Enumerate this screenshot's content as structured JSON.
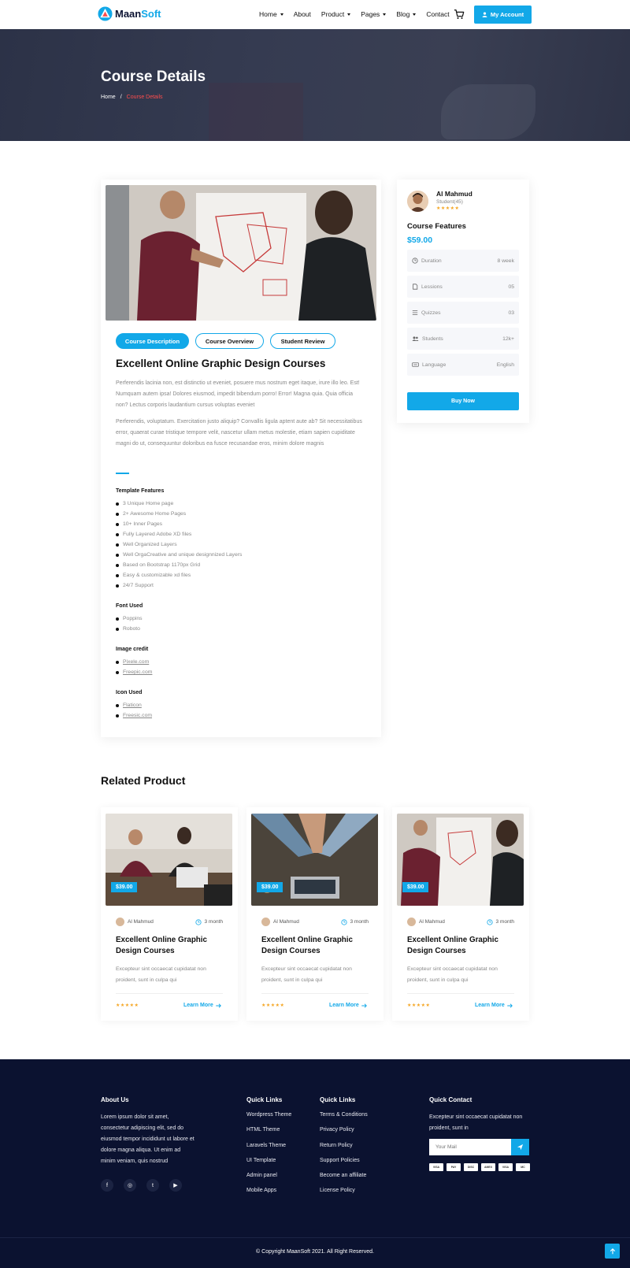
{
  "header": {
    "logo_prefix": "Maan",
    "logo_suffix": "Soft",
    "nav": [
      {
        "label": "Home",
        "dropdown": true
      },
      {
        "label": "About",
        "dropdown": false
      },
      {
        "label": "Product",
        "dropdown": true
      },
      {
        "label": "Pages",
        "dropdown": true
      },
      {
        "label": "Blog",
        "dropdown": true
      },
      {
        "label": "Contact",
        "dropdown": false
      }
    ],
    "account_label": "My Account"
  },
  "hero": {
    "title": "Course Details",
    "breadcrumb": [
      "Home",
      "/",
      "Course Details"
    ]
  },
  "course": {
    "tabs": [
      "Course Description",
      "Course Overview",
      "Student Review"
    ],
    "active_tab": "Course Description",
    "title": "Excellent Online Graphic Design Courses",
    "paragraph1": "Perferendis lacinia non, est distinctio ut eveniet, posuere mus nostrum eget itaque, irure illo leo. Est! Numquam autem ipsa! Dolores eiusmod, impedit bibendum porro! Error! Magna quia. Quia officia non? Lectus corporis laudantium cursus voluptas eveniet",
    "paragraph2": "Perferendis, voluptatum. Exercitation justo aliquip? Convallis ligula aptent aute ab? Sit necessitatibus error, quaerat curae tristique tempore velit, nascetur ullam metus molestie, etiam sapien cupiditate magni do ut, consequuntur doloribus ea fusce recusandae eros, minim dolore magnis",
    "template_features_title": "Template Features",
    "template_features": [
      "3 Unique Home page",
      "2+ Awesome Home Pages",
      "10+ Inner Pages",
      "Fully Layered Adobe XD files",
      "Well Organized Layers",
      "Well OrgaCreative and unique designnized Layers",
      "Based on Bootstrap 1170px Grid",
      "Easy & customizable xd files",
      "24/7 Support"
    ],
    "font_used_title": "Font Used",
    "font_used": [
      "Poppins",
      "Roboto"
    ],
    "image_credit_title": "Image credit",
    "image_credit": [
      "Pixele.com",
      "Freepic.com"
    ],
    "icon_used_title": "Icon Used",
    "icon_used": [
      "Flaticon",
      "Freesic.com"
    ]
  },
  "sidebar": {
    "instructor_name": "Al Mahmud",
    "instructor_role": "Student(45)",
    "stars": "★★★★★",
    "features_title": "Course Features",
    "price": "$59.00",
    "features": [
      {
        "icon": "clock-icon",
        "label": "Duration",
        "value": "8 week"
      },
      {
        "icon": "file-icon",
        "label": "Lessions",
        "value": "05"
      },
      {
        "icon": "list-icon",
        "label": "Quizzes",
        "value": "03"
      },
      {
        "icon": "users-icon",
        "label": "Students",
        "value": "12k+"
      },
      {
        "icon": "language-icon",
        "label": "Language",
        "value": "English"
      }
    ],
    "buy_label": "Buy Now"
  },
  "related": {
    "title": "Related Product",
    "cards": [
      {
        "price": "$39.00",
        "author": "Al Mahmud",
        "duration": "3 month",
        "title": "Excellent Online Graphic Design Courses",
        "desc": "Excepteur sint occaecat cupidatat non proident, sunt in culpa qui",
        "stars": "★★★★★",
        "more": "Learn More"
      },
      {
        "price": "$39.00",
        "author": "Al Mahmud",
        "duration": "3 month",
        "title": "Excellent Online Graphic Design Courses",
        "desc": "Excepteur sint occaecat cupidatat non proident, sunt in culpa qui",
        "stars": "★★★★★",
        "more": "Learn More"
      },
      {
        "price": "$39.00",
        "author": "Al Mahmud",
        "duration": "3 month",
        "title": "Excellent Online Graphic Design Courses",
        "desc": "Excepteur sint occaecat cupidatat non proident, sunt in culpa qui",
        "stars": "★★★★★",
        "more": "Learn More"
      }
    ]
  },
  "footer": {
    "about_title": "About Us",
    "about_text": "Lorem ipsum dolor sit amet, consectetur adipiscing elit, sed do eiusmod tempor incididunt ut labore et dolore magna aliqua. Ut enim ad minim veniam, quis nostrud",
    "social": [
      "f",
      "◎",
      "t",
      "▶"
    ],
    "links1_title": "Quick Links",
    "links1": [
      "Wordpress Theme",
      "HTML Theme",
      "Laravels Theme",
      "UI Template",
      "Admin panel",
      "Mobile Apps"
    ],
    "links2_title": "Quick Links",
    "links2": [
      "Terms & Conditions",
      "Privacy Policy",
      "Return Policy",
      "Support Policies",
      "Become an affiliate",
      "License Policy"
    ],
    "contact_title": "Quick Contact",
    "contact_text": "Excepteur sint occaecat cupidatat non proident, sunt in",
    "mail_placeholder": "Your Mail",
    "payments": [
      "VISA",
      "PAY",
      "DISC",
      "AMEX",
      "VISA",
      "MC"
    ],
    "copyright": "© Copyright MaanSoft 2021. All Right Reserved."
  },
  "colors": {
    "accent": "#12a8e8",
    "footer_bg": "#0b1230",
    "breadcrumb_current": "#ff4d4d",
    "star": "#f5a623"
  }
}
